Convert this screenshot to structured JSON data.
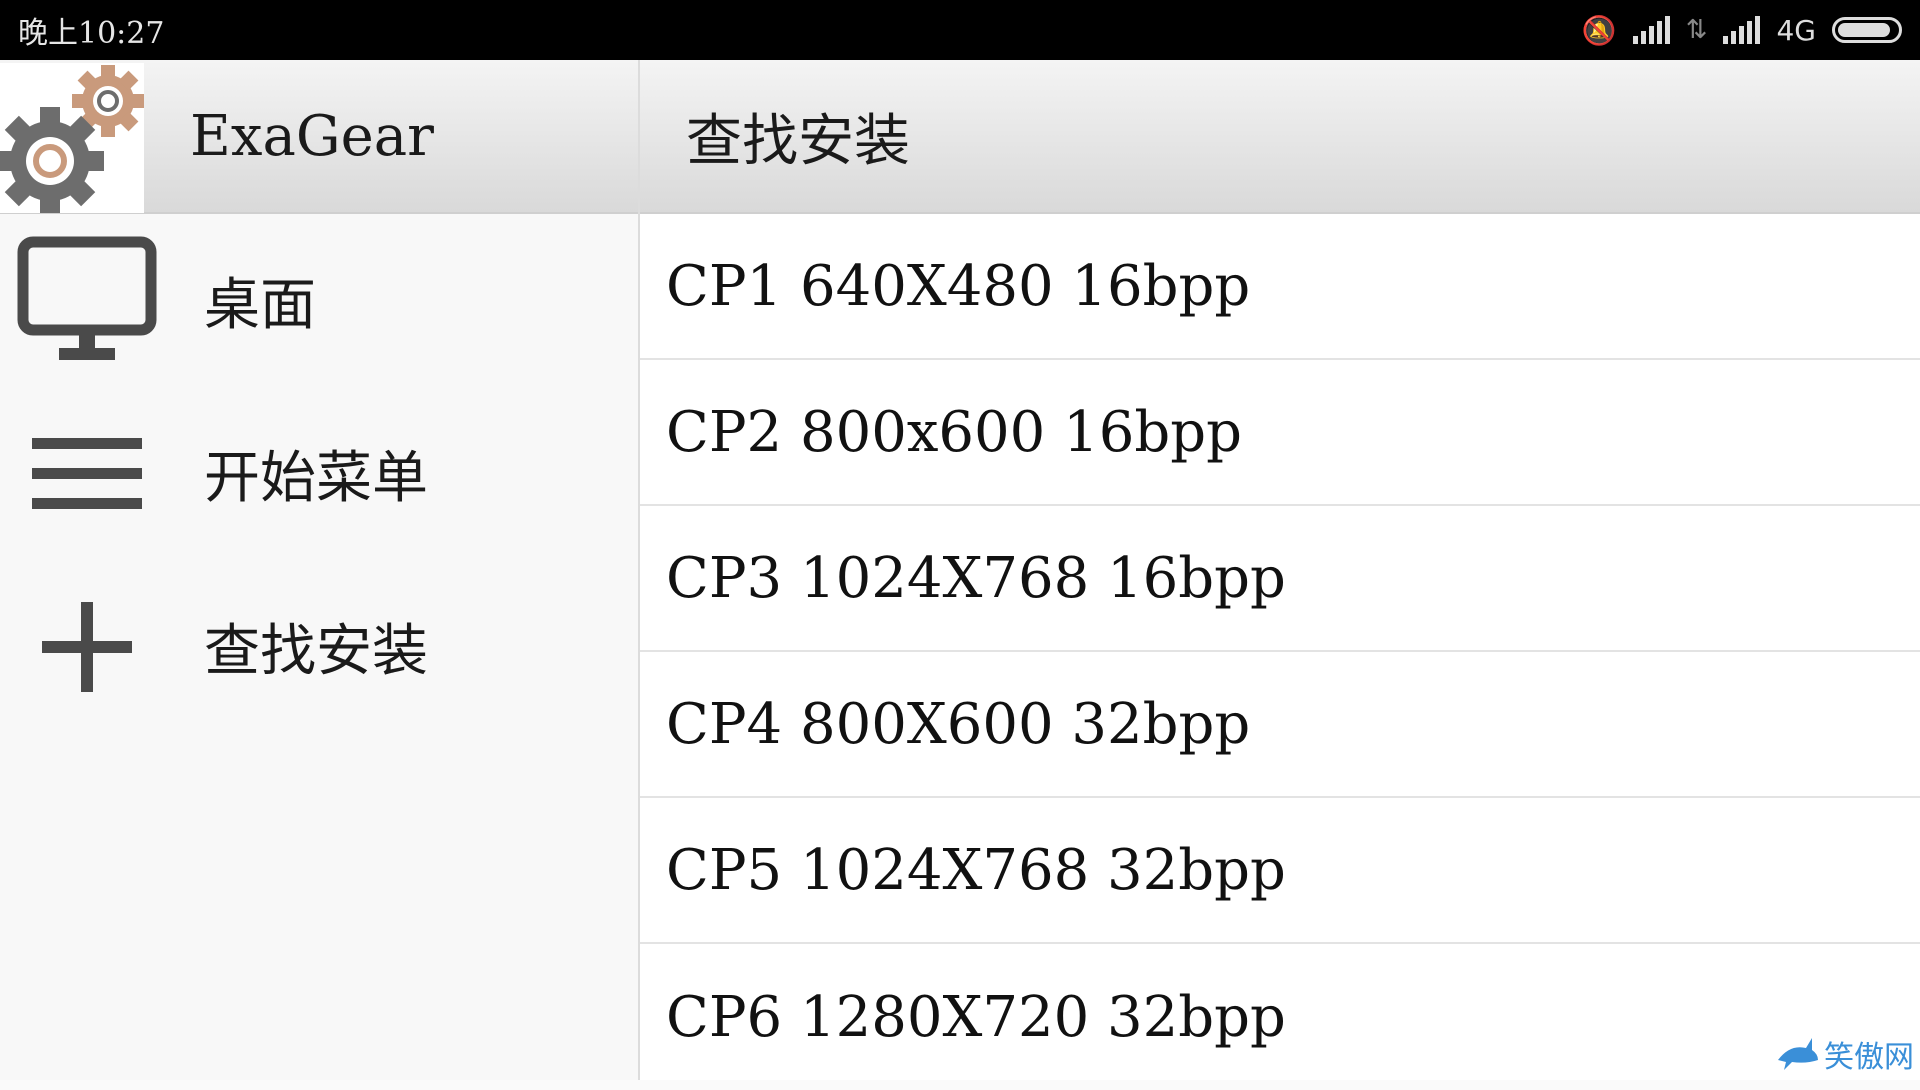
{
  "status_bar": {
    "time": "晚上10:27",
    "network": "4G",
    "battery_level": 0.9
  },
  "drawer": {
    "app_title": "ExaGear",
    "items": [
      {
        "label": "桌面",
        "icon": "monitor-icon"
      },
      {
        "label": "开始菜单",
        "icon": "menu-icon"
      },
      {
        "label": "查找安装",
        "icon": "plus-icon"
      }
    ]
  },
  "main": {
    "title": "查找安装",
    "rows": [
      "CP1 640X480 16bpp",
      "CP2 800x600 16bpp",
      "CP3 1024X768 16bpp",
      "CP4 800X600 32bpp",
      "CP5 1024X768 32bpp",
      "CP6 1280X720 32bpp"
    ]
  },
  "watermark": {
    "text": "笑傲网"
  },
  "colors": {
    "accent_gear": "#c99a7c",
    "gear_gray": "#6d6d6d",
    "icon_gray": "#4a4a4a"
  }
}
